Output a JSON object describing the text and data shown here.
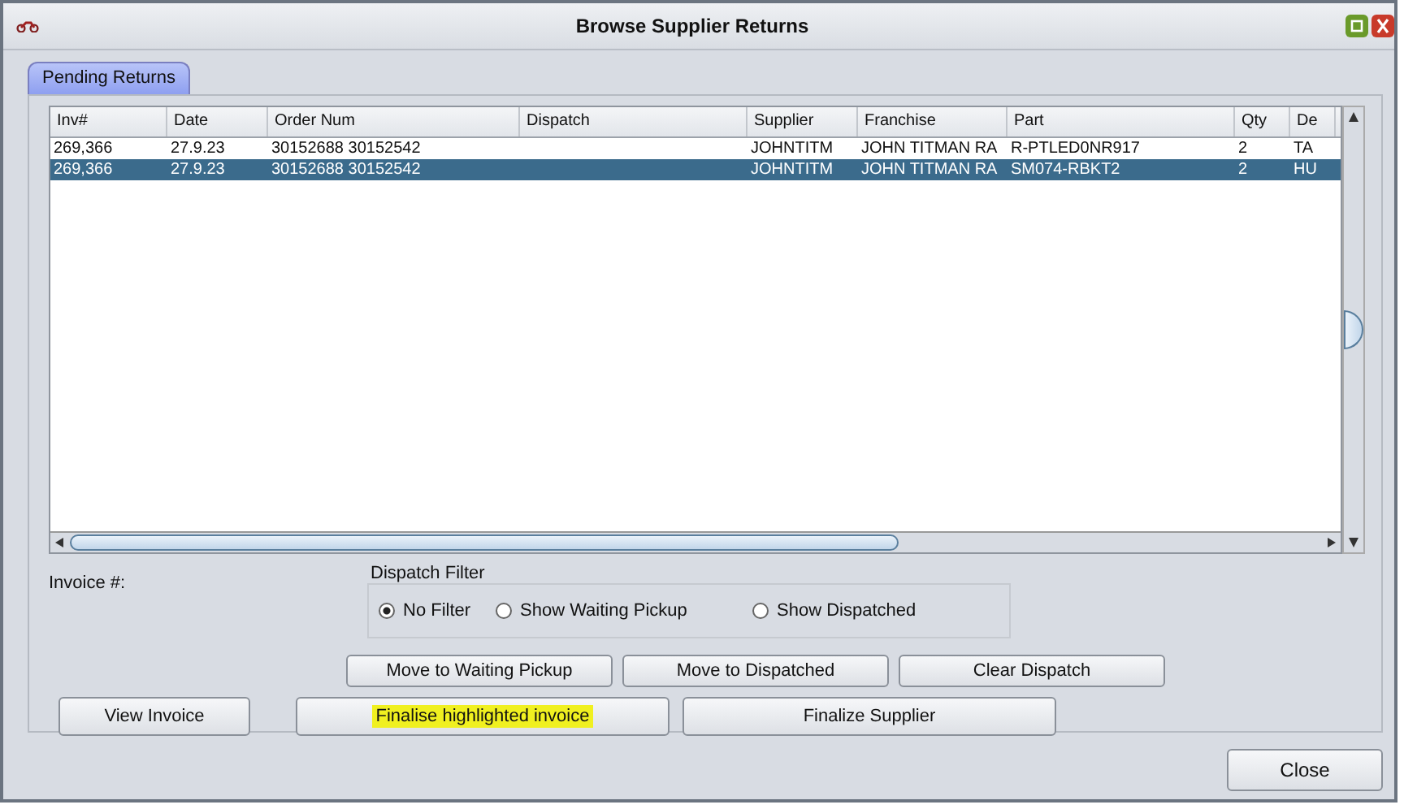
{
  "window": {
    "title": "Browse Supplier Returns"
  },
  "tabs": [
    {
      "label": "Pending Returns",
      "selected": true
    }
  ],
  "table": {
    "columns": [
      "Inv#",
      "Date",
      "Order Num",
      "Dispatch",
      "Supplier",
      "Franchise",
      "Part",
      "Qty",
      "De"
    ],
    "rows": [
      {
        "cells": [
          "269,366",
          "27.9.23",
          "30152688 30152542",
          "",
          "JOHNTITM",
          "JOHN TITMAN RA",
          "R-PTLED0NR917",
          "2",
          "TA"
        ],
        "selected": false
      },
      {
        "cells": [
          "269,366",
          "27.9.23",
          "30152688 30152542",
          "",
          "JOHNTITM",
          "JOHN TITMAN RA",
          "SM074-RBKT2",
          "2",
          "HU"
        ],
        "selected": true
      }
    ]
  },
  "invoice_label": "Invoice #:",
  "dispatch_filter": {
    "title": "Dispatch Filter",
    "options": [
      {
        "label": "No Filter",
        "selected": true
      },
      {
        "label": "Show Waiting Pickup",
        "selected": false
      },
      {
        "label": "Show Dispatched",
        "selected": false
      }
    ]
  },
  "dispatch_buttons": [
    "Move to Waiting Pickup",
    "Move to Dispatched",
    "Clear Dispatch"
  ],
  "action_buttons": [
    {
      "label": "View Invoice",
      "highlighted": false
    },
    {
      "label": "Finalise highlighted invoice",
      "highlighted": true
    },
    {
      "label": "Finalize Supplier",
      "highlighted": false
    }
  ],
  "close_button": "Close"
}
